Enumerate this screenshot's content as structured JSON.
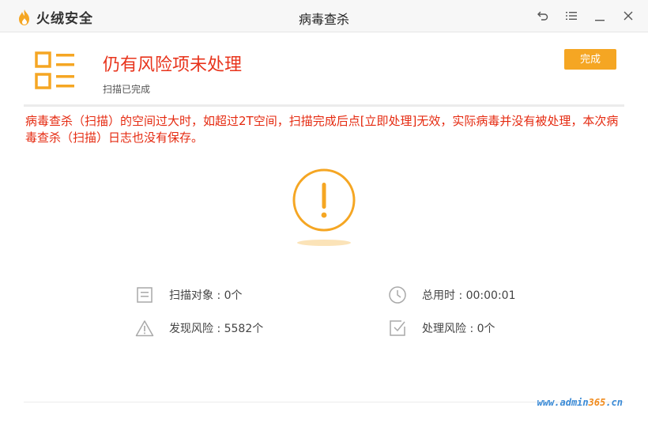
{
  "app": {
    "brand_name": "火绒安全",
    "window_title": "病毒查杀"
  },
  "colors": {
    "accent": "#f5a623",
    "warning_text": "#e52a10",
    "icon_gray": "#a9a9a9"
  },
  "icons": {
    "logo": "flame-logo-icon",
    "back": "back-arrow-icon",
    "menu": "menu-icon",
    "minimize": "minimize-icon",
    "close": "close-icon",
    "list": "list-icon",
    "alert": "exclamation-icon"
  },
  "status": {
    "title": "仍有风险项未处理",
    "subtitle": "扫描已完成",
    "done_label": "完成"
  },
  "warning_text": "病毒查杀（扫描）的空间过大时，如超过2T空间，扫描完成后点[立即处理]无效，实际病毒并没有被处理，本次病毒查杀（扫描）日志也没有保存。",
  "stats": {
    "scan_objects": "扫描对象 : 0个",
    "total_time": "总用时 : 00:00:01",
    "risks_found": "发现风险 : 5582个",
    "risks_handled": "处理风险 : 0个"
  },
  "watermark": {
    "prefix": "www.admin",
    "highlight": "365",
    "suffix": ".cn"
  }
}
